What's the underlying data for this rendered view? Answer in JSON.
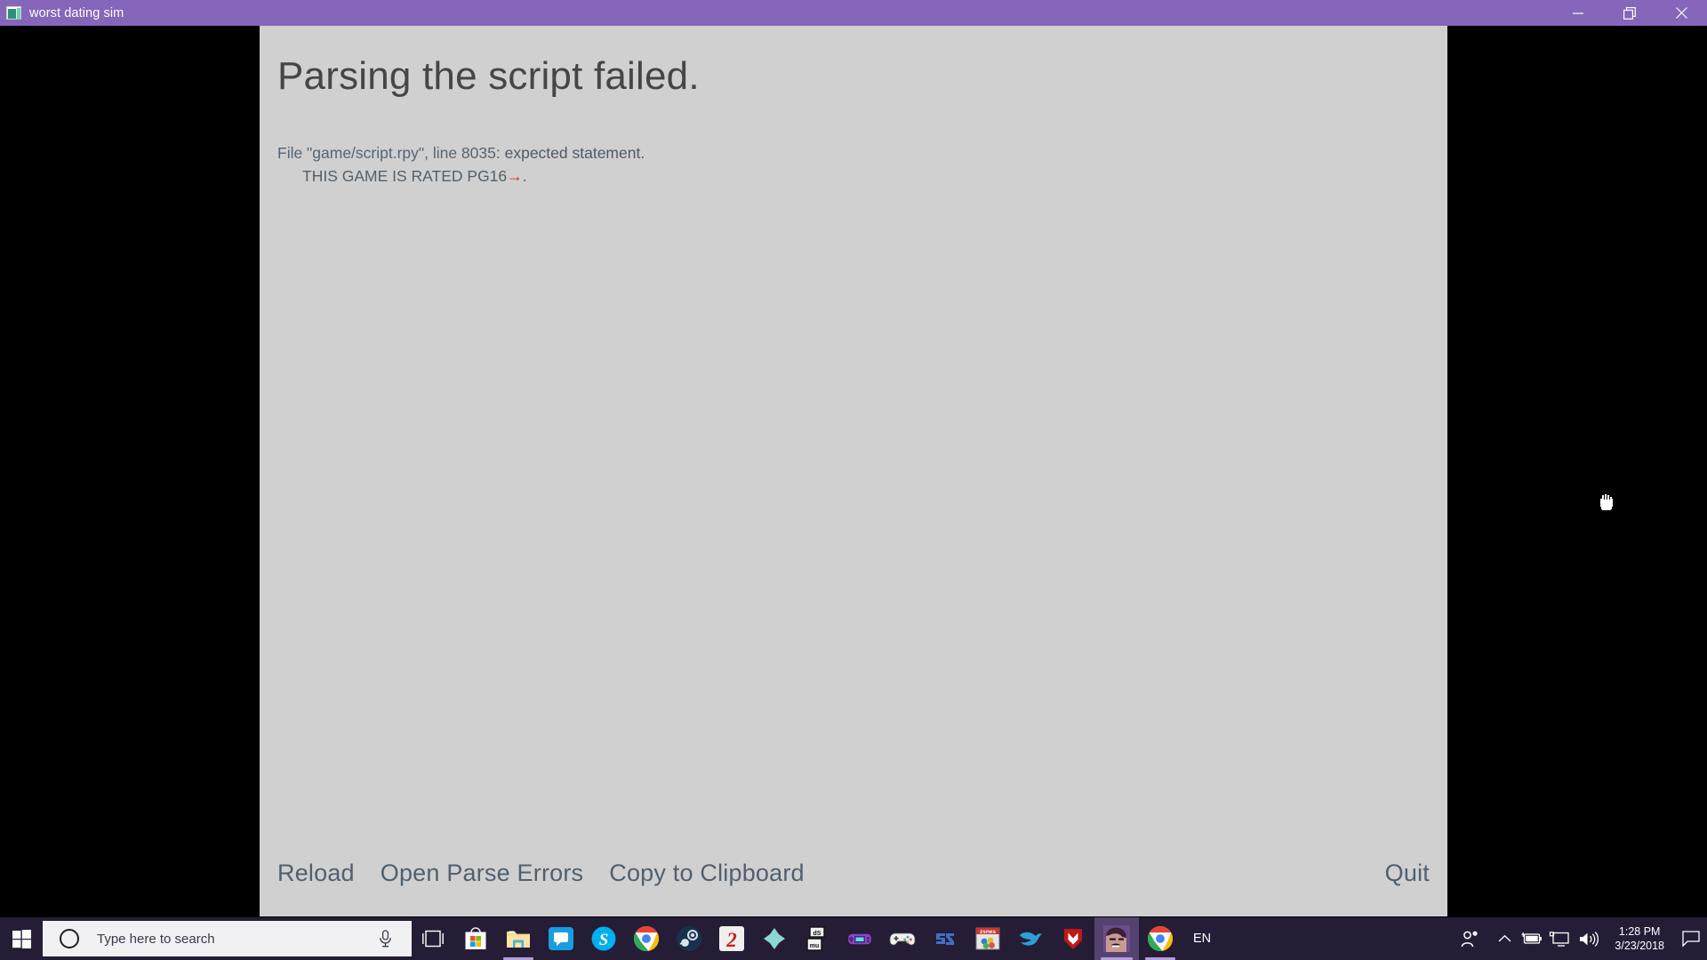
{
  "window": {
    "title": "worst dating sim",
    "icon": "renpy-window-icon",
    "controls": [
      {
        "name": "minimize-button",
        "glyph": "minimize-icon"
      },
      {
        "name": "restore-button",
        "glyph": "restore-icon"
      },
      {
        "name": "close-button",
        "glyph": "close-icon"
      }
    ],
    "titlebar_color": "#8566bb"
  },
  "error_screen": {
    "heading": "Parsing the script failed.",
    "lines": [
      {
        "prefix": "File \"game/script.rpy\", line 8035",
        "suffix": ": expected statement.",
        "indent": false
      },
      {
        "text": "THIS GAME IS RATED PG16",
        "arrow": "→",
        "tail": ".",
        "indent": true
      }
    ],
    "background_color": "#d0d0d0",
    "text_color": "#4e5a66",
    "arrow_color": "#e01b1b",
    "buttons": [
      {
        "name": "reload-button",
        "label": "Reload"
      },
      {
        "name": "open-parse-errors-button",
        "label": "Open Parse Errors"
      },
      {
        "name": "copy-to-clipboard-button",
        "label": "Copy to Clipboard"
      }
    ],
    "quit_button": {
      "name": "quit-button",
      "label": "Quit"
    }
  },
  "cursor": {
    "type": "fist-hand-cursor"
  },
  "taskbar": {
    "background_color": "#251d36",
    "start": {
      "name": "start-button",
      "label": "Start"
    },
    "search": {
      "placeholder": "Type here to search",
      "ring_icon": "cortana-circle-icon",
      "mic_icon": "microphone-icon"
    },
    "task_view": {
      "name": "task-view-button",
      "icon": "task-view-icon"
    },
    "pinned": [
      {
        "name": "microsoft-store",
        "icon": "microsoft-store-icon",
        "active": false,
        "running": false
      },
      {
        "name": "file-explorer",
        "icon": "file-explorer-icon",
        "active": false,
        "running": true
      },
      {
        "name": "chat-app",
        "icon": "chat-bubble-icon",
        "active": false,
        "running": false
      },
      {
        "name": "skype",
        "icon": "skype-icon",
        "active": false,
        "running": false
      },
      {
        "name": "google-chrome",
        "icon": "chrome-icon",
        "active": false,
        "running": false
      },
      {
        "name": "steam",
        "icon": "steam-icon",
        "active": false,
        "running": false
      },
      {
        "name": "emulator-red-two",
        "icon": "red-two-logo-icon",
        "active": false,
        "running": false
      },
      {
        "name": "ppsspp",
        "icon": "ppsspp-cross-icon",
        "active": false,
        "running": false
      },
      {
        "name": "desmume",
        "icon": "desmume-icon",
        "active": false,
        "running": false
      },
      {
        "name": "visualboy-advance",
        "icon": "gba-handheld-icon",
        "active": false,
        "running": false
      },
      {
        "name": "epsxe",
        "icon": "gamepad-icon",
        "active": false,
        "running": false
      },
      {
        "name": "pcsx2",
        "icon": "pcsx2-icon",
        "active": false,
        "running": false
      },
      {
        "name": "zsnes",
        "icon": "zsnes-icon",
        "active": false,
        "running": false
      },
      {
        "name": "dolphin-emulator",
        "icon": "dolphin-icon",
        "active": false,
        "running": false
      },
      {
        "name": "mcafee",
        "icon": "mcafee-shield-icon",
        "active": false,
        "running": false
      },
      {
        "name": "worst-dating-sim",
        "icon": "game-avatar-icon",
        "active": true,
        "running": true
      },
      {
        "name": "google-chrome-window",
        "icon": "chrome-icon",
        "active": false,
        "running": true
      }
    ],
    "language": "EN",
    "tray": [
      {
        "name": "people-icon",
        "icon": "people-icon"
      },
      {
        "name": "show-hidden-icons",
        "icon": "chevron-up-icon"
      },
      {
        "name": "battery-icon",
        "icon": "battery-charging-icon"
      },
      {
        "name": "network-icon",
        "icon": "monitor-network-icon"
      },
      {
        "name": "volume-icon",
        "icon": "speaker-icon"
      }
    ],
    "clock": {
      "time": "1:28 PM",
      "date": "3/23/2018"
    },
    "action_center": {
      "name": "action-center-button",
      "icon": "speech-bubble-icon"
    }
  }
}
